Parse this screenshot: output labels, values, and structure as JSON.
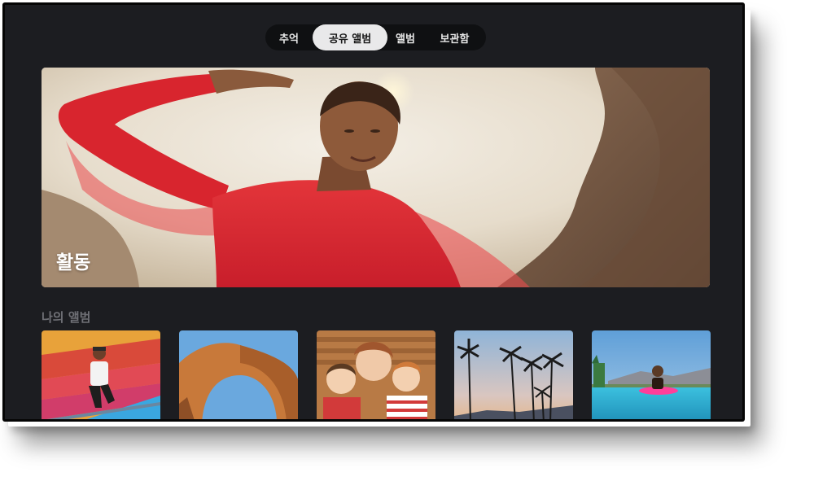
{
  "tabs": {
    "memories": "추억",
    "shared_albums": "공유 앨범",
    "albums": "앨범",
    "library": "보관함",
    "selected": "공유 앨범"
  },
  "hero": {
    "title": "활동"
  },
  "my_albums": {
    "section_title": "나의 앨범",
    "items": [
      {
        "scene": "person-on-colorful-stairs"
      },
      {
        "scene": "rock-arch"
      },
      {
        "scene": "family-selfie"
      },
      {
        "scene": "palm-trees-sunset"
      },
      {
        "scene": "person-in-pool"
      }
    ]
  },
  "colors": {
    "screen_bg": "#1c1d21",
    "tab_bar_bg": "#0f1012",
    "tab_selected_bg": "#e9e9ea",
    "section_title": "#6f7076"
  }
}
